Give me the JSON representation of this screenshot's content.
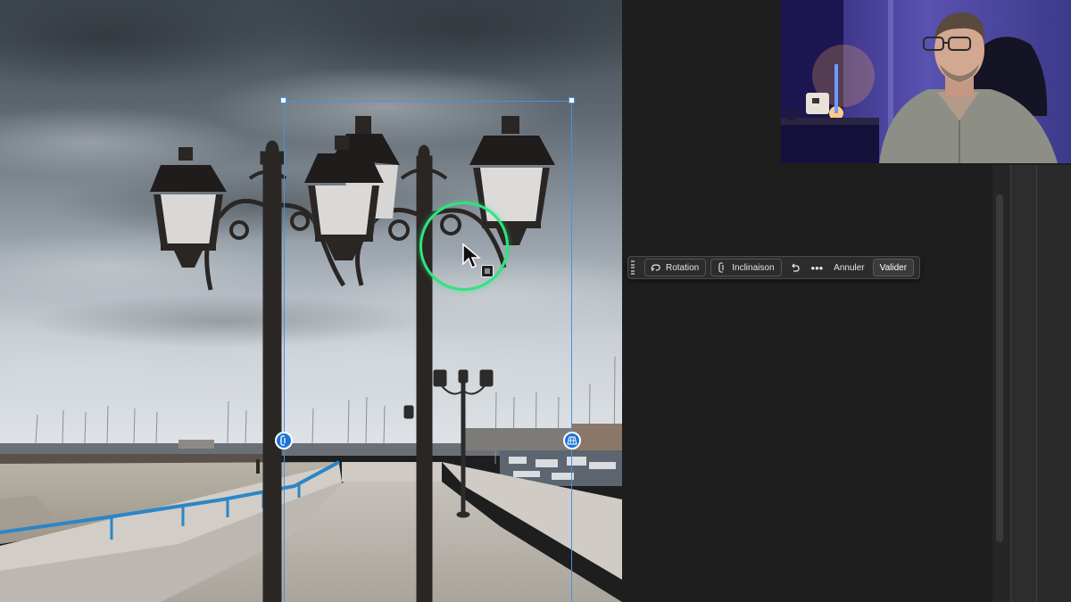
{
  "taskbar": {
    "grip_icon": "drag-handle-icon",
    "rotation_label": "Rotation",
    "rotation_icon": "rotate-loop-icon",
    "skew_label": "Inclinaison",
    "skew_icon": "skew-icon",
    "undo_icon": "undo-icon",
    "more_label": "•••",
    "cancel_label": "Annuler",
    "confirm_label": "Valider"
  },
  "canvas": {
    "subject": "street-lamp-photo",
    "selection_handles": [
      "skew-handle-icon",
      "perspective-grid-icon"
    ]
  },
  "colors": {
    "selection_blue": "#4a90e2",
    "cursor_ring": "#2ee57f",
    "handle_fill": "#1c74d9",
    "ui_background": "#1e1e1e",
    "taskbar_background": "#2c2c2c"
  }
}
